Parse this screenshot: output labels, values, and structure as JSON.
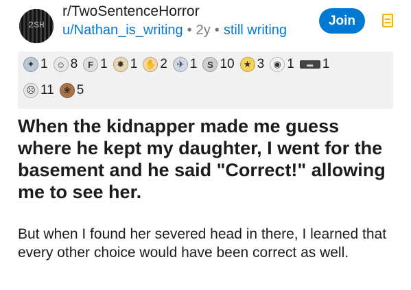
{
  "post": {
    "subreddit": "r/TwoSentenceHorror",
    "author": "u/Nathan_is_writing",
    "age": "2y",
    "flair": "still writing",
    "join_label": "Join",
    "avatar_text": "2SH",
    "title": "When the kidnapper made me guess where he kept my daughter, I went for the basement and he said \"Correct!\" allowing me to see her.",
    "body": "But when I found her severed head in there, I learned that every other choice would have been correct as well."
  },
  "awards": [
    {
      "icon": "silver-award-icon",
      "glyph": "✦",
      "count": "1",
      "color": "#b9c8d6"
    },
    {
      "icon": "wholesome-award-icon",
      "glyph": "☺",
      "count": "8",
      "color": "#e8e8e8"
    },
    {
      "icon": "f-award-icon",
      "glyph": "F",
      "count": "1",
      "color": "#e0e0e0"
    },
    {
      "icon": "mindblown-award-icon",
      "glyph": "✹",
      "count": "1",
      "color": "#ead6b4"
    },
    {
      "icon": "hand-award-icon",
      "glyph": "✋",
      "count": "2",
      "color": "#f3d8a6"
    },
    {
      "icon": "rocket-award-icon",
      "glyph": "✈",
      "count": "1",
      "color": "#cfd8e6"
    },
    {
      "icon": "silver-s-award-icon",
      "glyph": "S",
      "count": "10",
      "color": "#cfcfcf"
    },
    {
      "icon": "gold-award-icon",
      "glyph": "★",
      "count": "3",
      "color": "#f5d25a"
    },
    {
      "icon": "panda-award-icon",
      "glyph": "◉",
      "count": "1",
      "color": "#f2f2f2"
    },
    {
      "icon": "banner-award-icon",
      "glyph": "▬",
      "count": "1",
      "color": "#444444"
    },
    {
      "icon": "grimace-award-icon",
      "glyph": "☹",
      "count": "11",
      "color": "#e6e6e6"
    },
    {
      "icon": "bear-award-icon",
      "glyph": "❀",
      "count": "5",
      "color": "#a7734a"
    }
  ],
  "colors": {
    "accent": "#0079d3",
    "text": "#1c1c1c",
    "muted": "#787c7e",
    "award_bg": "#f1f1f1",
    "save": "#f4b300"
  }
}
